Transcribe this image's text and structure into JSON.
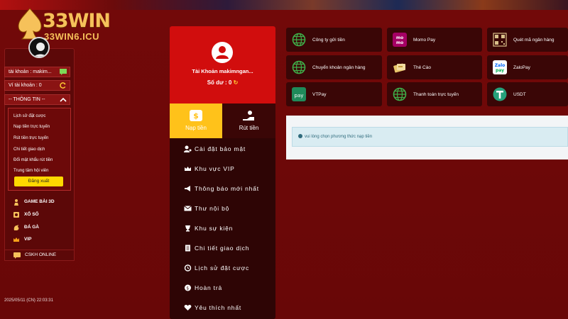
{
  "logo": {
    "brand": "33WIN",
    "domain": "33WIN6.ICU"
  },
  "sidebar": {
    "account_label": "tài khoản : makim...",
    "wallet_label": "Ví tài khoản : 0",
    "info_toggle": "-- THÔNG TIN --",
    "dropdown": [
      "Lịch sử đặt cược",
      "Nạp tiền trực tuyến",
      "Rút tiền trực tuyến",
      "Chi tiết giao dịch",
      "Đổi mật khẩu rút tiền",
      "Trung tâm hội viên"
    ],
    "logout": "Đăng xuất",
    "menu": [
      "GAME BÀI 3D",
      "XỔ SỐ",
      "ĐÁ GÀ",
      "VIP"
    ],
    "cskh": "CSKH ONLINE",
    "timestamp": "2025/05/11 (CN) 22:03:31"
  },
  "account": {
    "name": "Tài Khoản makimngan...",
    "balance": "Số dư : 0"
  },
  "tabs": {
    "deposit": "Nạp tiền",
    "withdraw": "Rút tiền"
  },
  "nav": [
    "Cài đặt bảo mật",
    "Khu vực VIP",
    "Thông báo mới nhất",
    "Thư nội bộ",
    "Khu sự kiện",
    "Chi tiết giao dịch",
    "Lịch sử đặt cược",
    "Hoàn trả",
    "Yêu thích nhất"
  ],
  "payments": [
    {
      "label": "Công ty gửi tiền",
      "icon": "globe-icon"
    },
    {
      "label": "Momo Pay",
      "icon": "momo-icon"
    },
    {
      "label": "Quét mã ngân hàng",
      "icon": "qr-icon"
    },
    {
      "label": "Chuyển khoản ngân hàng",
      "icon": "globe-icon"
    },
    {
      "label": "Thẻ Cào",
      "icon": "card-icon"
    },
    {
      "label": "ZaloPay",
      "icon": "zalopay-icon"
    },
    {
      "label": "VTPay",
      "icon": "vtpay-icon"
    },
    {
      "label": "Thanh toán trực tuyến",
      "icon": "globe-icon"
    },
    {
      "label": "USDT",
      "icon": "usdt-icon"
    }
  ],
  "notice": "vui lòng chọn phương thức nạp tiền",
  "colors": {
    "accent": "#d10d0d",
    "tab_active": "#ffc21a",
    "logo_gold": "#f6c15a",
    "bg": "#720909"
  }
}
